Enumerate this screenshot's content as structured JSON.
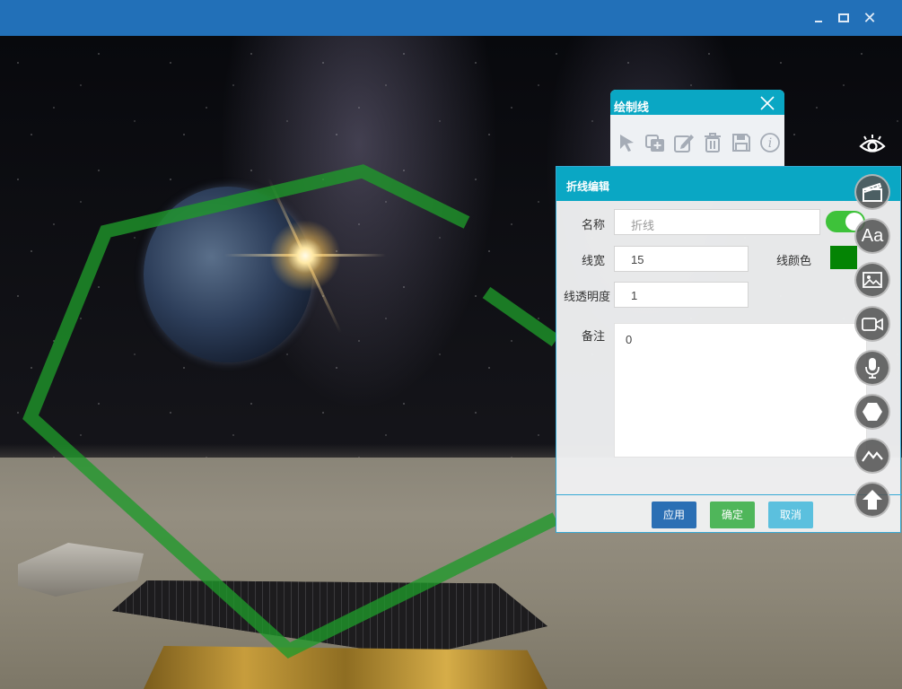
{
  "window": {
    "minimize_icon": "minimize-icon",
    "maximize_icon": "maximize-icon",
    "close_icon": "close-icon",
    "close_glyph": "✕"
  },
  "draw_panel": {
    "title": "绘制线",
    "tools": [
      "select-arrow-icon",
      "add-copy-icon",
      "edit-pencil-icon",
      "trash-icon",
      "save-disk-icon",
      "info-icon"
    ]
  },
  "edit_panel": {
    "title": "折线编辑",
    "name_label": "名称",
    "name_placeholder": "折线",
    "width_label": "线宽",
    "width_value": "15",
    "color_label": "线颜色",
    "color_value": "#048404",
    "opacity_label": "线透明度",
    "opacity_value": "1",
    "note_label": "备注",
    "note_value": "0",
    "toggle_on": true,
    "buttons": {
      "apply": "应用",
      "ok": "确定",
      "cancel": "取消"
    }
  },
  "side_tools": {
    "text_label": "Aa",
    "icons": [
      "clapperboard-icon",
      "text-icon",
      "image-icon",
      "video-icon",
      "microphone-icon",
      "hexagon-icon",
      "mountain-icon",
      "arrow-up-icon"
    ]
  },
  "colors": {
    "title_bar": "#2270b8",
    "panel_header": "#0aa7c4",
    "polyline": "#1f9a2a"
  }
}
